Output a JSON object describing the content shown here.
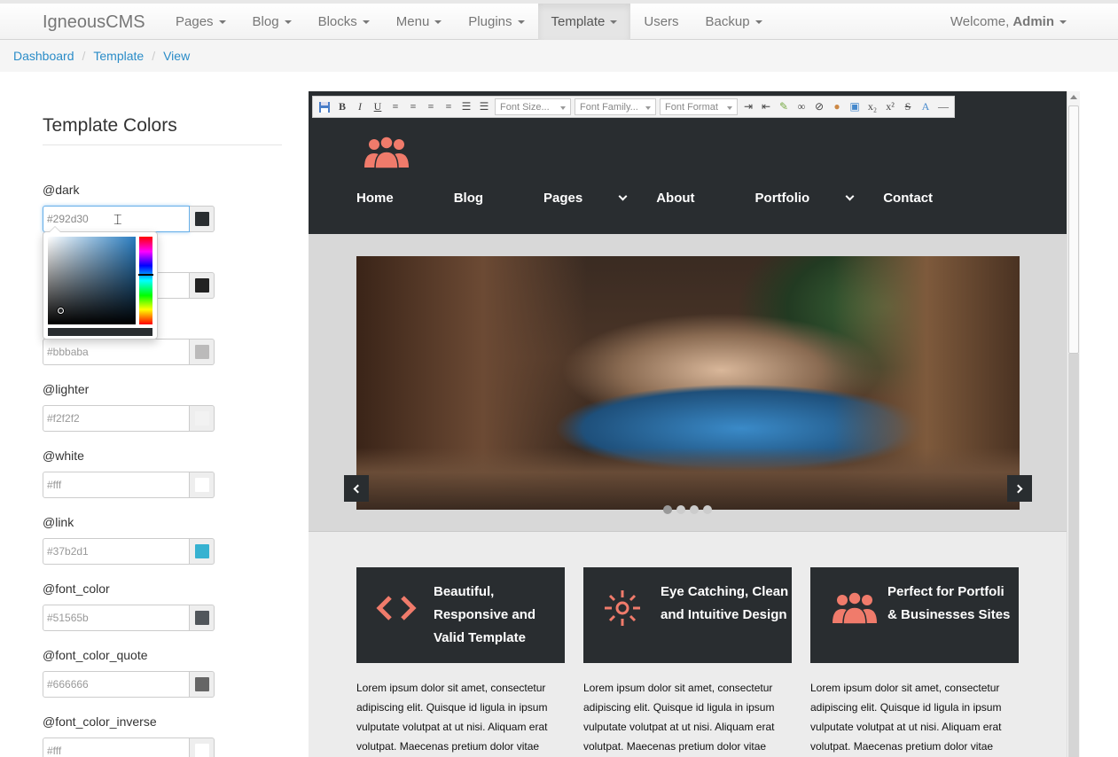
{
  "app": {
    "brand": "IgneousCMS"
  },
  "nav": {
    "items": [
      {
        "label": "Pages",
        "dropdown": true
      },
      {
        "label": "Blog",
        "dropdown": true
      },
      {
        "label": "Blocks",
        "dropdown": true
      },
      {
        "label": "Menu",
        "dropdown": true
      },
      {
        "label": "Plugins",
        "dropdown": true
      },
      {
        "label": "Template",
        "dropdown": true,
        "active": true
      },
      {
        "label": "Users",
        "dropdown": false
      },
      {
        "label": "Backup",
        "dropdown": true
      }
    ],
    "welcome_prefix": "Welcome,",
    "welcome_user": "Admin"
  },
  "breadcrumb": [
    "Dashboard",
    "Template",
    "View"
  ],
  "panel": {
    "title": "Template Colors",
    "fields": [
      {
        "label": "@dark",
        "value": "#292d30",
        "color": "#292d30"
      },
      {
        "label": "",
        "value": "",
        "color": "#222222"
      },
      {
        "label": "",
        "value": "#bbbaba",
        "color": "#bbbaba"
      },
      {
        "label": "@lighter",
        "value": "#f2f2f2",
        "color": "#f2f2f2"
      },
      {
        "label": "@white",
        "value": "#fff",
        "color": "#ffffff"
      },
      {
        "label": "@link",
        "value": "#37b2d1",
        "color": "#37b2d1"
      },
      {
        "label": "@font_color",
        "value": "#51565b",
        "color": "#51565b"
      },
      {
        "label": "@font_color_quote",
        "value": "#666666",
        "color": "#666666"
      },
      {
        "label": "@font_color_inverse",
        "value": "#fff",
        "color": "#ffffff"
      }
    ]
  },
  "editor_toolbar": {
    "font_size": "Font Size...",
    "font_family": "Font Family...",
    "font_format": "Font Format"
  },
  "preview": {
    "accent": "#f07b6b",
    "dark": "#292d30",
    "nav": [
      {
        "label": "Home",
        "dropdown": false
      },
      {
        "label": "Blog",
        "dropdown": false
      },
      {
        "label": "Pages",
        "dropdown": true
      },
      {
        "label": "About",
        "dropdown": false
      },
      {
        "label": "Portfolio",
        "dropdown": true
      },
      {
        "label": "Contact",
        "dropdown": false
      }
    ],
    "features": [
      {
        "icon": "code-icon",
        "title": "Beautiful, Responsive and Valid Template",
        "text": "Lorem ipsum dolor sit amet, consectetur adipiscing elit. Quisque id ligula in ipsum vulputate volutpat at ut nisi. Aliquam erat volutpat. Maecenas pretium dolor vitae"
      },
      {
        "icon": "sun-icon",
        "title": "Eye Catching, Clean and Intuitive Design",
        "text": "Lorem ipsum dolor sit amet, consectetur adipiscing elit. Quisque id ligula in ipsum vulputate volutpat at ut nisi. Aliquam erat volutpat. Maecenas pretium dolor vitae"
      },
      {
        "icon": "users-icon",
        "title": "Perfect for Portfoli & Businesses Sites",
        "text": "Lorem ipsum dolor sit amet, consectetur adipiscing elit. Quisque id ligula in ipsum vulputate volutpat at ut nisi. Aliquam erat volutpat. Maecenas pretium dolor vitae"
      }
    ]
  }
}
